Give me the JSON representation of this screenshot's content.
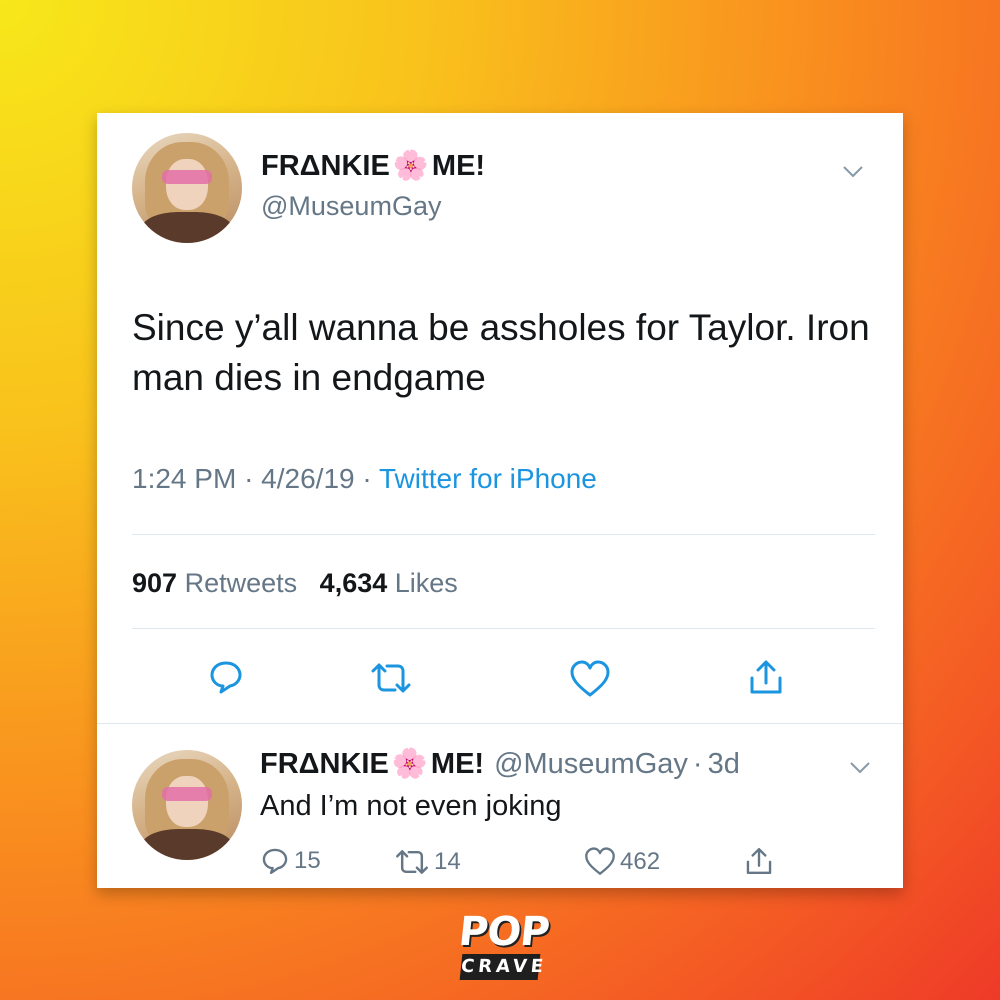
{
  "tweet": {
    "display_name_part1": "FRΔNKIE",
    "display_name_emoji": "🌸",
    "display_name_part2": "ME!",
    "handle": "@MuseumGay",
    "text": "Since y’all wanna be assholes for Taylor. Iron man dies in endgame",
    "time": "1:24 PM",
    "separator": "·",
    "date": "4/26/19",
    "source": "Twitter for iPhone",
    "retweets_count": "907",
    "retweets_label": "Retweets",
    "likes_count": "4,634",
    "likes_label": "Likes"
  },
  "reply": {
    "display_name_part1": "FRΔNKIE",
    "display_name_emoji": "🌸",
    "display_name_part2": "ME!",
    "handle": "@MuseumGay",
    "separator": "·",
    "age": "3d",
    "text": "And I’m not even joking",
    "reply_count": "15",
    "retweet_count": "14",
    "like_count": "462"
  },
  "logo": {
    "line1": "POP",
    "line2": "CRAVE"
  },
  "colors": {
    "link": "#1b95e0",
    "muted": "#657786",
    "text": "#14171a",
    "divider": "#e1e8ed"
  },
  "icons": [
    "reply-icon",
    "retweet-icon",
    "like-icon",
    "share-icon",
    "chevron-down-icon",
    "cherry-blossom-icon"
  ]
}
